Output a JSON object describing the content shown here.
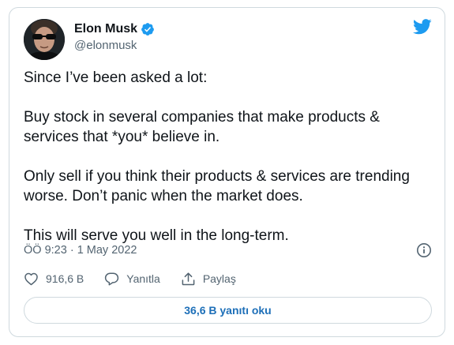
{
  "author": {
    "display_name": "Elon Musk",
    "handle": "@elonmusk",
    "verified": true,
    "avatar_icon": "profile-photo"
  },
  "tweet": {
    "paragraphs": [
      "Since I’ve been asked a lot:",
      "Buy stock in several companies that make products & services that *you* believe in.",
      "Only sell if you think their products & services are trending worse. Don’t panic when the market does.",
      "This will serve you well in the long-term."
    ],
    "timestamp": "ÖÖ 9:23 · 1 May 2022"
  },
  "actions": {
    "like_count": "916,6 B",
    "reply_label": "Yanıtla",
    "share_label": "Paylaş"
  },
  "replies_button_label": "36,6 B yanıtı oku",
  "colors": {
    "brand": "#1d9bf0",
    "link": "#1d6fb8",
    "text": "#0f1419",
    "muted": "#536471",
    "border": "#cfd9de"
  },
  "icons": [
    "verified-badge-icon",
    "twitter-bird-icon",
    "info-icon",
    "heart-icon",
    "reply-bubble-icon",
    "share-icon"
  ]
}
